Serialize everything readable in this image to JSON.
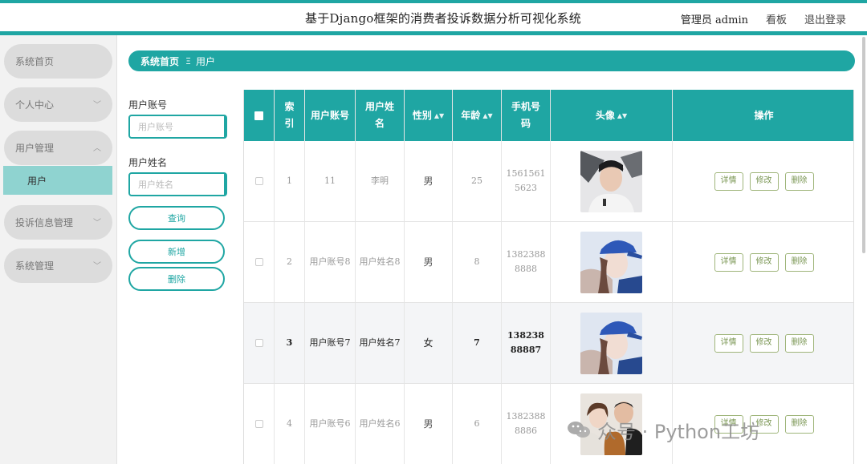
{
  "header": {
    "title": "基于Django框架的消费者投诉数据分析可视化系统",
    "admin_label": "管理员 admin",
    "board_label": "看板",
    "logout_label": "退出登录"
  },
  "sidebar": {
    "items": [
      {
        "label": "系统首页"
      },
      {
        "label": "个人中心"
      },
      {
        "label": "用户管理"
      },
      {
        "label": "用户"
      },
      {
        "label": "投诉信息管理"
      },
      {
        "label": "系统管理"
      }
    ]
  },
  "breadcrumb": {
    "home": "系统首页",
    "separator": "Ξ",
    "current": "用户"
  },
  "search": {
    "account_label": "用户账号",
    "account_placeholder": "用户账号",
    "name_label": "用户姓名",
    "name_placeholder": "用户姓名",
    "query_button": "查询",
    "add_button": "新增",
    "delete_button": "删除"
  },
  "table": {
    "headers": [
      "索引",
      "用户账号",
      "用户姓名",
      "性别",
      "年龄",
      "手机号码",
      "头像",
      "操作"
    ],
    "rows": [
      {
        "index": "1",
        "account": "11",
        "name": "李明",
        "gender": "男",
        "age": "25",
        "phone": "15615615623",
        "avatar": "young man portrait"
      },
      {
        "index": "2",
        "account": "用户账号8",
        "name": "用户姓名8",
        "gender": "男",
        "age": "8",
        "phone": "13823888888",
        "avatar": "woman with blue cap"
      },
      {
        "index": "3",
        "account": "用户账号7",
        "name": "用户姓名7",
        "gender": "女",
        "age": "7",
        "phone": "13823888887",
        "avatar": "woman with blue cap"
      },
      {
        "index": "4",
        "account": "用户账号6",
        "name": "用户姓名6",
        "gender": "男",
        "age": "6",
        "phone": "13823888886",
        "avatar": "couple with dog"
      }
    ],
    "actions": {
      "detail": "详情",
      "edit": "修改",
      "delete": "删除"
    }
  },
  "watermark": {
    "text": "众号 · Python工坊"
  },
  "colors": {
    "accent": "#1fa6a3",
    "sidebar_active": "#8fd3d0",
    "action_border": "#9fb57a"
  }
}
